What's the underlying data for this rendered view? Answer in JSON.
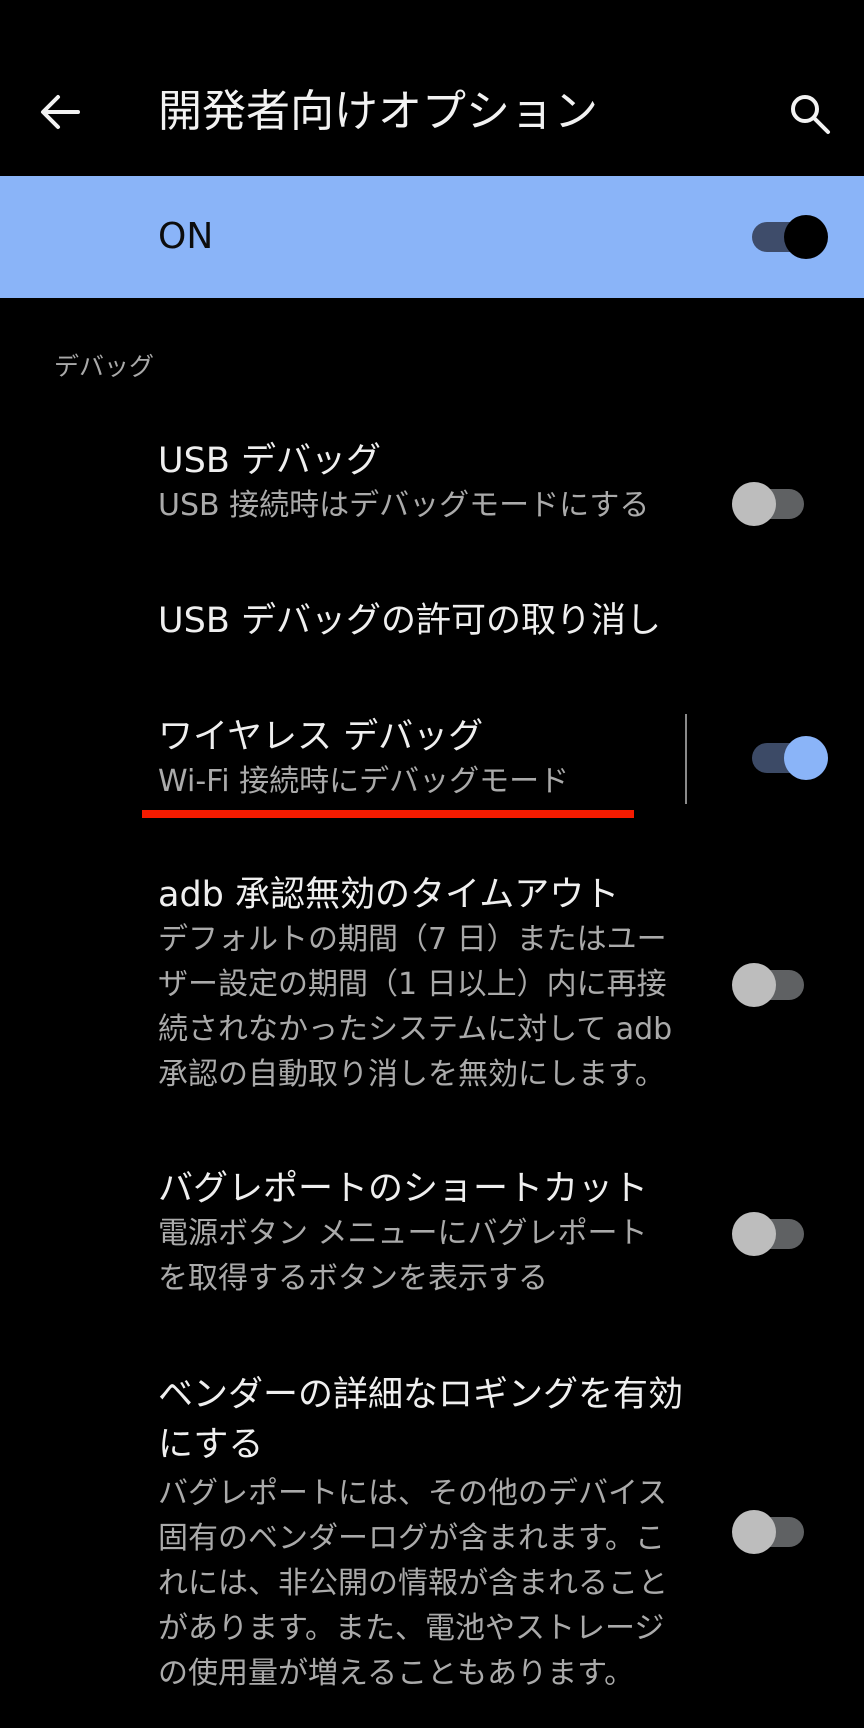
{
  "app_bar": {
    "title": "開発者向けオプション",
    "back_icon": "arrow-back-icon",
    "search_icon": "search-icon"
  },
  "master_switch": {
    "label": "ON",
    "checked": true
  },
  "section": {
    "header": "デバッグ"
  },
  "items": [
    {
      "title": "USB デバッグ",
      "summary": [
        "USB 接続時はデバッグモードにする"
      ],
      "toggle": false
    },
    {
      "title": "USB デバッグの許可の取り消し",
      "summary": []
    },
    {
      "title": "ワイヤレス デバッグ",
      "summary": [
        "Wi-Fi 接続時にデバッグモード"
      ],
      "toggle": true
    },
    {
      "title": "adb 承認無効のタイムアウト",
      "summary": [
        "デフォルトの期間（7 日）またはユー",
        "ザー設定の期間（1 日以上）内に再接",
        "続されなかったシステムに対して adb",
        "承認の自動取り消しを無効にします。"
      ],
      "toggle": false
    },
    {
      "title": "バグレポートのショートカット",
      "summary": [
        "電源ボタン メニューにバグレポート",
        "を取得するボタンを表示する"
      ],
      "toggle": false
    },
    {
      "title": [
        "ベンダーの詳細なロギングを有効",
        "にする"
      ],
      "summary": [
        "バグレポートには、その他のデバイス",
        "固有のベンダーログが含まれます。こ",
        "れには、非公開の情報が含まれること",
        "があります。また、電池やストレージ",
        "の使用量が増えることもあります。"
      ],
      "toggle": false
    }
  ],
  "colors": {
    "accent": "#8ab4f8",
    "annotation": "#f61b00",
    "background": "#000000"
  }
}
